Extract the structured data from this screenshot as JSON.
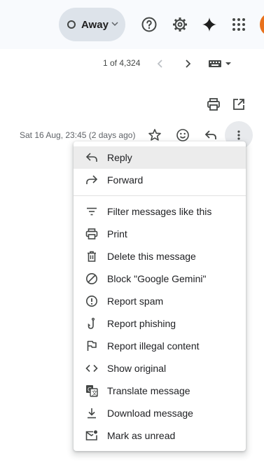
{
  "header": {
    "status_label": "Away",
    "icons": [
      "help-icon",
      "settings-icon",
      "gemini-icon",
      "apps-icon",
      "avatar"
    ]
  },
  "pager": {
    "count_text": "1 of 4,324"
  },
  "message": {
    "date_text": "Sat 16 Aug, 23:45 (2 days ago)"
  },
  "menu": {
    "items": [
      {
        "label": "Reply",
        "icon": "reply-icon",
        "highlighted": true
      },
      {
        "label": "Forward",
        "icon": "forward-icon"
      },
      {
        "label": "Filter messages like this",
        "icon": "filter-icon"
      },
      {
        "label": "Print",
        "icon": "print-icon"
      },
      {
        "label": "Delete this message",
        "icon": "trash-icon"
      },
      {
        "label": "Block \"Google Gemini\"",
        "icon": "block-icon"
      },
      {
        "label": "Report spam",
        "icon": "report-spam-icon"
      },
      {
        "label": "Report phishing",
        "icon": "phishing-hook-icon"
      },
      {
        "label": "Report illegal content",
        "icon": "flag-icon"
      },
      {
        "label": "Show original",
        "icon": "code-icon"
      },
      {
        "label": "Translate message",
        "icon": "translate-icon"
      },
      {
        "label": "Download message",
        "icon": "download-icon"
      },
      {
        "label": "Mark as unread",
        "icon": "mark-unread-icon"
      }
    ]
  },
  "colors": {
    "header_bg": "#f8fafd",
    "status_pill_bg": "#dde3ea",
    "menu_highlight": "#ececec",
    "more_button_bg": "#e8eaed",
    "avatar": "#e8711c"
  }
}
